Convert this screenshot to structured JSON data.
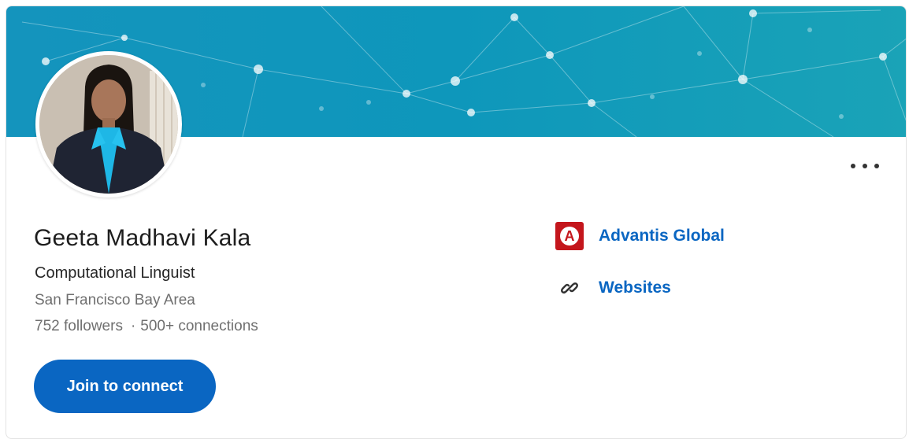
{
  "profile": {
    "name": "Geeta Madhavi Kala",
    "headline": "Computational Linguist",
    "location": "San Francisco Bay Area",
    "followers": "752 followers",
    "separator": "·",
    "connections": "500+ connections"
  },
  "actions": {
    "join_label": "Join to connect"
  },
  "sidebar": {
    "company": "Advantis Global",
    "company_logo_letter": "A",
    "websites": "Websites"
  },
  "icons": {
    "more": "more-horizontal-icon",
    "company_logo": "company-logo-icon",
    "link": "link-icon"
  },
  "colors": {
    "brand_blue": "#0a66c2",
    "banner_teal": "#1494bd",
    "company_red": "#c4161c"
  }
}
